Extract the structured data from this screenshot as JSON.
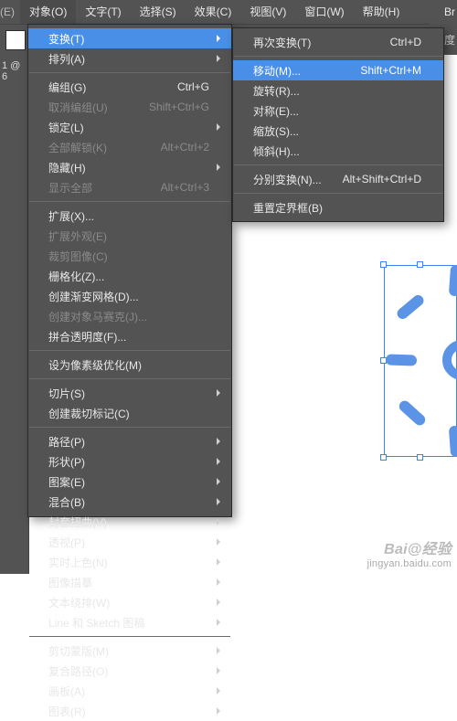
{
  "menubar": {
    "edge_left": "(E)",
    "items": [
      {
        "label": "对象(O)",
        "active": true
      },
      {
        "label": "文字(T)"
      },
      {
        "label": "选择(S)"
      },
      {
        "label": "效果(C)"
      },
      {
        "label": "视图(V)"
      },
      {
        "label": "窗口(W)"
      },
      {
        "label": "帮助(H)"
      }
    ],
    "edge_right": "Br"
  },
  "toolbar": {
    "right_label": "明度",
    "left_readout": "1  @ 6"
  },
  "menu1": [
    {
      "t": "item",
      "label": "变换(T)",
      "sub": true,
      "hover": true
    },
    {
      "t": "item",
      "label": "排列(A)",
      "sub": true
    },
    {
      "t": "sep"
    },
    {
      "t": "item",
      "label": "编组(G)",
      "shortcut": "Ctrl+G"
    },
    {
      "t": "item",
      "label": "取消编组(U)",
      "shortcut": "Shift+Ctrl+G",
      "disabled": true
    },
    {
      "t": "item",
      "label": "锁定(L)",
      "sub": true
    },
    {
      "t": "item",
      "label": "全部解锁(K)",
      "shortcut": "Alt+Ctrl+2",
      "disabled": true
    },
    {
      "t": "item",
      "label": "隐藏(H)",
      "sub": true
    },
    {
      "t": "item",
      "label": "显示全部",
      "shortcut": "Alt+Ctrl+3",
      "disabled": true
    },
    {
      "t": "sep"
    },
    {
      "t": "item",
      "label": "扩展(X)..."
    },
    {
      "t": "item",
      "label": "扩展外观(E)",
      "disabled": true
    },
    {
      "t": "item",
      "label": "裁剪图像(C)",
      "disabled": true
    },
    {
      "t": "item",
      "label": "栅格化(Z)..."
    },
    {
      "t": "item",
      "label": "创建渐变网格(D)..."
    },
    {
      "t": "item",
      "label": "创建对象马赛克(J)...",
      "disabled": true
    },
    {
      "t": "item",
      "label": "拼合透明度(F)..."
    },
    {
      "t": "sep"
    },
    {
      "t": "item",
      "label": "设为像素级优化(M)"
    },
    {
      "t": "sep"
    },
    {
      "t": "item",
      "label": "切片(S)",
      "sub": true
    },
    {
      "t": "item",
      "label": "创建裁切标记(C)"
    },
    {
      "t": "sep"
    },
    {
      "t": "item",
      "label": "路径(P)",
      "sub": true
    },
    {
      "t": "item",
      "label": "形状(P)",
      "sub": true
    },
    {
      "t": "item",
      "label": "图案(E)",
      "sub": true
    },
    {
      "t": "item",
      "label": "混合(B)",
      "sub": true
    },
    {
      "t": "item",
      "label": "封套扭曲(V)",
      "sub": true
    },
    {
      "t": "item",
      "label": "透视(P)",
      "sub": true
    },
    {
      "t": "item",
      "label": "实时上色(N)",
      "sub": true
    },
    {
      "t": "item",
      "label": "图像描摹",
      "sub": true
    },
    {
      "t": "item",
      "label": "文本绕排(W)",
      "sub": true
    },
    {
      "t": "item",
      "label": "Line 和 Sketch 图稿",
      "sub": true
    },
    {
      "t": "sep"
    },
    {
      "t": "item",
      "label": "剪切蒙版(M)",
      "sub": true
    },
    {
      "t": "item",
      "label": "复合路径(O)",
      "sub": true
    },
    {
      "t": "item",
      "label": "画板(A)",
      "sub": true
    },
    {
      "t": "item",
      "label": "图表(R)",
      "sub": true
    }
  ],
  "menu2": [
    {
      "t": "item",
      "label": "再次变换(T)",
      "shortcut": "Ctrl+D"
    },
    {
      "t": "sep"
    },
    {
      "t": "item",
      "label": "移动(M)...",
      "shortcut": "Shift+Ctrl+M",
      "hover": true
    },
    {
      "t": "item",
      "label": "旋转(R)..."
    },
    {
      "t": "item",
      "label": "对称(E)..."
    },
    {
      "t": "item",
      "label": "缩放(S)..."
    },
    {
      "t": "item",
      "label": "倾斜(H)..."
    },
    {
      "t": "sep"
    },
    {
      "t": "item",
      "label": "分别变换(N)...",
      "shortcut": "Alt+Shift+Ctrl+D"
    },
    {
      "t": "sep"
    },
    {
      "t": "item",
      "label": "重置定界框(B)"
    }
  ],
  "watermark": {
    "line1": "Bai@经验",
    "line2": "jingyan.baidu.com"
  }
}
